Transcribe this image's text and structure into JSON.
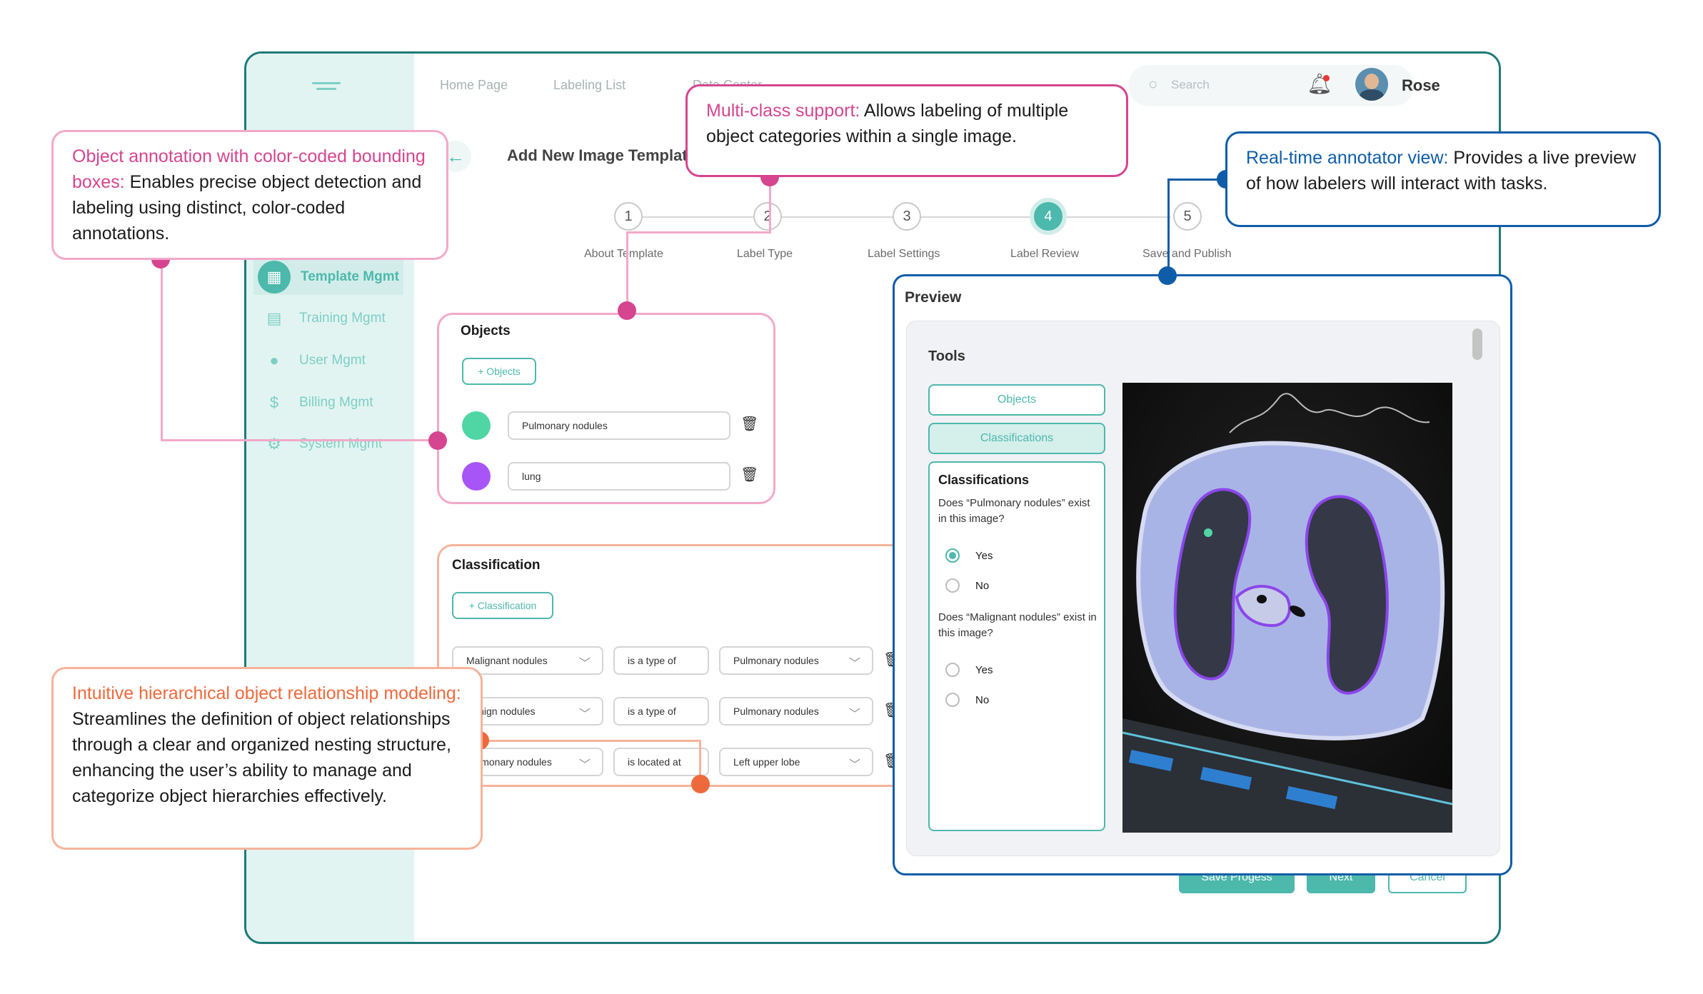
{
  "nav": {
    "links": [
      "Home Page",
      "Labeling List",
      "Data Center"
    ],
    "search_placeholder": "Search",
    "user_name": "Rose"
  },
  "page": {
    "back_icon": "arrow-left-icon",
    "title": "Add New Image Template"
  },
  "sidebar": {
    "items": [
      {
        "label": "Template Mgmt",
        "icon": "grid-icon",
        "active": true
      },
      {
        "label": "Training Mgmt",
        "icon": "calendar-icon"
      },
      {
        "label": "User Mgmt",
        "icon": "user-icon"
      },
      {
        "label": "Billing Mgmt",
        "icon": "dollar-icon"
      },
      {
        "label": "System Mgmt",
        "icon": "gear-icon"
      }
    ]
  },
  "steps": [
    {
      "num": "1",
      "label": "About Template"
    },
    {
      "num": "2",
      "label": "Label Type"
    },
    {
      "num": "3",
      "label": "Label Settings"
    },
    {
      "num": "4",
      "label": "Label Review",
      "active": true
    },
    {
      "num": "5",
      "label": "Save and Publish"
    }
  ],
  "objects": {
    "title": "Objects",
    "add_button": "+ Objects",
    "items": [
      {
        "name": "Pulmonary nodules",
        "color": "#4fd6a4"
      },
      {
        "name": "lung",
        "color": "#a855f7"
      }
    ]
  },
  "classification": {
    "title": "Classification",
    "add_button": "+ Classification",
    "rows": [
      {
        "a": "Malignant nodules",
        "rel": "is a type of",
        "b": "Pulmonary nodules"
      },
      {
        "a": "Benign nodules",
        "rel": "is a type of",
        "b": "Pulmonary nodules"
      },
      {
        "a": "Pulmonary nodules",
        "rel": "is located at",
        "b": "Left upper lobe"
      }
    ]
  },
  "preview": {
    "title": "Preview",
    "tools_title": "Tools",
    "tool_objects": "Objects",
    "tool_classifications": "Classifications",
    "panel_title": "Classifications",
    "q1": "Does “Pulmonary nodules” exist in this image?",
    "q2": "Does “Malignant nodules” exist in this image?",
    "yes": "Yes",
    "no": "No"
  },
  "footer_buttons": {
    "save": "Save Progess",
    "next": "Next",
    "cancel": "Cancel"
  },
  "callouts": {
    "bbox": {
      "highlight": "Object annotation with color-coded bounding boxes:",
      "text": " Enables precise object detection and labeling using distinct, color-coded annotations.",
      "color": "#d6458f"
    },
    "multiclass": {
      "highlight": "Multi-class support:",
      "text": " Allows labeling of multiple object categories within a single image.",
      "color": "#d6458f"
    },
    "realtime": {
      "highlight": "Real-time annotator view:",
      "text": " Provides a live preview of how labelers will interact with tasks.",
      "color": "#0f5da8"
    },
    "hierarchy": {
      "highlight": "Intuitive hierarchical object relationship modeling:",
      "text": " Streamlines the definition of object relationships through a clear and organized nesting structure, enhancing the user’s ability to manage and categorize object hierarchies effectively.",
      "color": "#ee6a3c"
    }
  },
  "colors": {
    "accent": "#4db8ac",
    "frame": "#1d7b78",
    "pink": "#d6458f",
    "blue": "#0f5da8",
    "orange": "#ee6a3c"
  }
}
